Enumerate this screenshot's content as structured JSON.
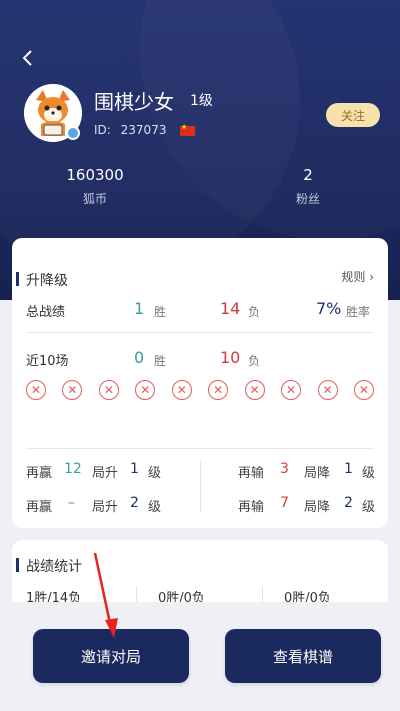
{
  "profile": {
    "username": "围棋少女",
    "level": "1级",
    "id_label": "ID:",
    "id_value": "237073",
    "follow_label": "关注",
    "stats": [
      {
        "value": "160300",
        "label": "狐币"
      },
      {
        "value": "2",
        "label": "粉丝"
      }
    ]
  },
  "rank": {
    "title": "升降级",
    "rules_label": "规则",
    "total_label": "总战绩",
    "total_wins": "1",
    "win_unit": "胜",
    "total_losses": "14",
    "loss_unit": "负",
    "win_rate": "7%",
    "win_rate_label": "胜率",
    "recent_label": "近10场",
    "recent_wins": "0",
    "recent_losses": "10",
    "recent_results": [
      "✕",
      "✕",
      "✕",
      "✕",
      "✕",
      "✕",
      "✕",
      "✕",
      "✕",
      "✕"
    ],
    "promo": {
      "win_again_label": "再赢",
      "lose_again_label": "再输",
      "promote_label": "局升",
      "demote_label": "局降",
      "level_unit": "级",
      "rows": [
        {
          "win_n": "12",
          "up_lv": "1",
          "lose_n": "3",
          "down_lv": "1"
        },
        {
          "win_n": "–",
          "up_lv": "2",
          "lose_n": "7",
          "down_lv": "2"
        }
      ]
    }
  },
  "record": {
    "title": "战绩统计",
    "cells": [
      "1胜/14负",
      "0胜/0负",
      "0胜/0负"
    ]
  },
  "actions": {
    "invite_label": "邀请对局",
    "view_label": "查看棋谱"
  },
  "colors": {
    "header": "#1f2f6e",
    "win": "#3a9e9a",
    "loss": "#d23b3b",
    "button": "#1b2a5e",
    "arrow": "#e8231e"
  }
}
